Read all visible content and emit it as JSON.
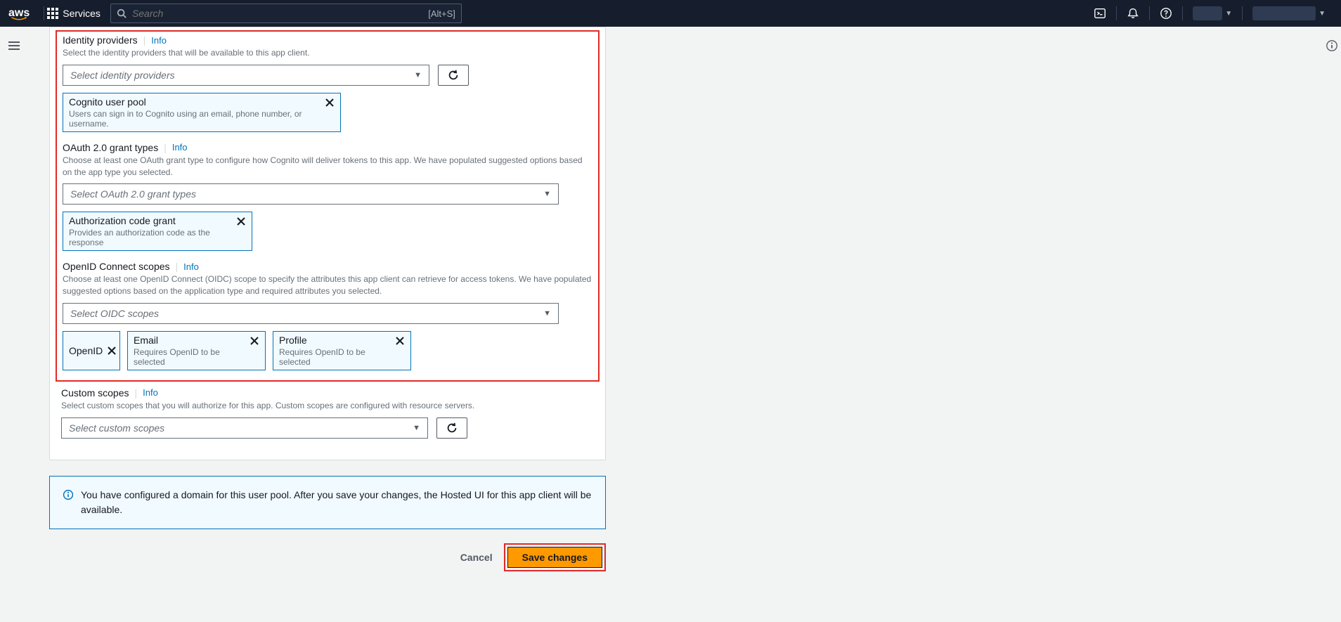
{
  "nav": {
    "logo": "aws",
    "services": "Services",
    "search_placeholder": "Search",
    "search_hint": "[Alt+S]"
  },
  "sections": {
    "idp": {
      "title": "Identity providers",
      "info": "Info",
      "desc": "Select the identity providers that will be available to this app client.",
      "placeholder": "Select identity providers",
      "tag": {
        "title": "Cognito user pool",
        "desc": "Users can sign in to Cognito using an email, phone number, or username."
      }
    },
    "grant": {
      "title": "OAuth 2.0 grant types",
      "info": "Info",
      "desc": "Choose at least one OAuth grant type to configure how Cognito will deliver tokens to this app. We have populated suggested options based on the app type you selected.",
      "placeholder": "Select OAuth 2.0 grant types",
      "tag": {
        "title": "Authorization code grant",
        "desc": "Provides an authorization code as the response"
      }
    },
    "oidc": {
      "title": "OpenID Connect scopes",
      "info": "Info",
      "desc": "Choose at least one OpenID Connect (OIDC) scope to specify the attributes this app client can retrieve for access tokens. We have populated suggested options based on the application type and required attributes you selected.",
      "placeholder": "Select OIDC scopes",
      "tags": [
        {
          "title": "OpenID"
        },
        {
          "title": "Email",
          "desc": "Requires OpenID to be selected"
        },
        {
          "title": "Profile",
          "desc": "Requires OpenID to be selected"
        }
      ]
    },
    "custom": {
      "title": "Custom scopes",
      "info": "Info",
      "desc": "Select custom scopes that you will authorize for this app. Custom scopes are configured with resource servers.",
      "placeholder": "Select custom scopes"
    }
  },
  "banner": "You have configured a domain for this user pool. After you save your changes, the Hosted UI for this app client will be available.",
  "actions": {
    "cancel": "Cancel",
    "save": "Save changes"
  }
}
